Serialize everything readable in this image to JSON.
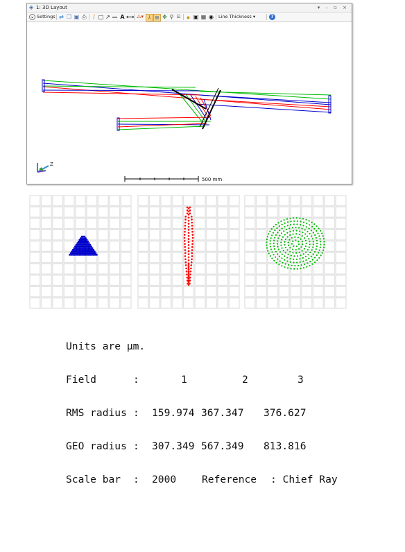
{
  "window": {
    "title": "1: 3D Layout",
    "controls": "▾ – ▫ ×"
  },
  "toolbar": {
    "settings_label": "Settings",
    "line_thickness_label": "Line Thickness",
    "icons": [
      "refresh-icon",
      "copy-icon",
      "save-icon",
      "print-icon",
      "pencil-icon",
      "rectangle-icon",
      "arrow-icon",
      "line-icon",
      "text-icon",
      "dimension-icon",
      "layout-icon",
      "axis-icon",
      "zoom-in-icon",
      "rotate-icon",
      "zoom-icon",
      "fit-icon",
      "lock-icon",
      "window-icon",
      "clip-icon",
      "camera-icon",
      "help-icon"
    ]
  },
  "layout": {
    "scale_label": "500 mm",
    "axis_label": "Z",
    "ray_colors": {
      "field1": "#0000cc",
      "field2": "#00bb00",
      "field3": "#ff0000"
    }
  },
  "spot_diagram": {
    "units_line": "Units are µm.",
    "field_label": "Field",
    "rms_label": "RMS radius",
    "geo_label": "GEO radius",
    "scale_label": "Scale bar",
    "colon": ":",
    "fields": [
      "1",
      "2",
      "3"
    ],
    "rms": [
      "159.974",
      "367.347",
      "376.627"
    ],
    "geo": [
      "307.349",
      "567.349",
      "813.816"
    ],
    "scale_value": "2000",
    "reference_label": "Reference",
    "reference_value": ": Chief Ray",
    "spot_colors": [
      "#0000cc",
      "#ff0000",
      "#00bb00"
    ]
  }
}
